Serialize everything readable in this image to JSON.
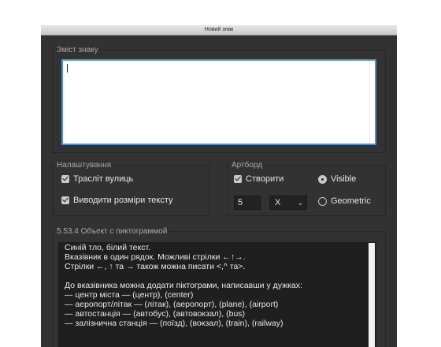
{
  "window": {
    "title": "Новий знак"
  },
  "content": {
    "legend": "Зміст знаку",
    "value": ""
  },
  "settings": {
    "legend": "Налаштування",
    "transliterate_label": "Трасліт вулиць",
    "show_size_label": "Виводити розміри тексту"
  },
  "artboard": {
    "legend": "Артборд",
    "create_label": "Створити",
    "visible_label": "Visible",
    "geometric_label": "Geometric",
    "number_value": "5",
    "select_value": "X"
  },
  "object": {
    "legend": "5.53.4 Объект с пиктограммой",
    "lines": [
      "Синій тло, білий текст.",
      "Вказівник в один рядок. Можливі стрілки ←↑→.",
      "Стрілки ←, ↑ та → також можна писати <,^ та>.",
      "",
      "До вказівника можна додати піктограми, написавши у дужках:",
      "— центр міста — (центр), (center)",
      "— аеропорт/літак — (літак), (аеропорт), (plane), (airport)",
      "— автостанція — (автобус), (автовокзал), (bus)",
      "— залізнична станція — (поїзд), (вокзал), (train), (railway)"
    ]
  },
  "state": {
    "transliterate_checked": true,
    "show_size_checked": true,
    "create_checked": true,
    "selected_mode": "Visible"
  }
}
